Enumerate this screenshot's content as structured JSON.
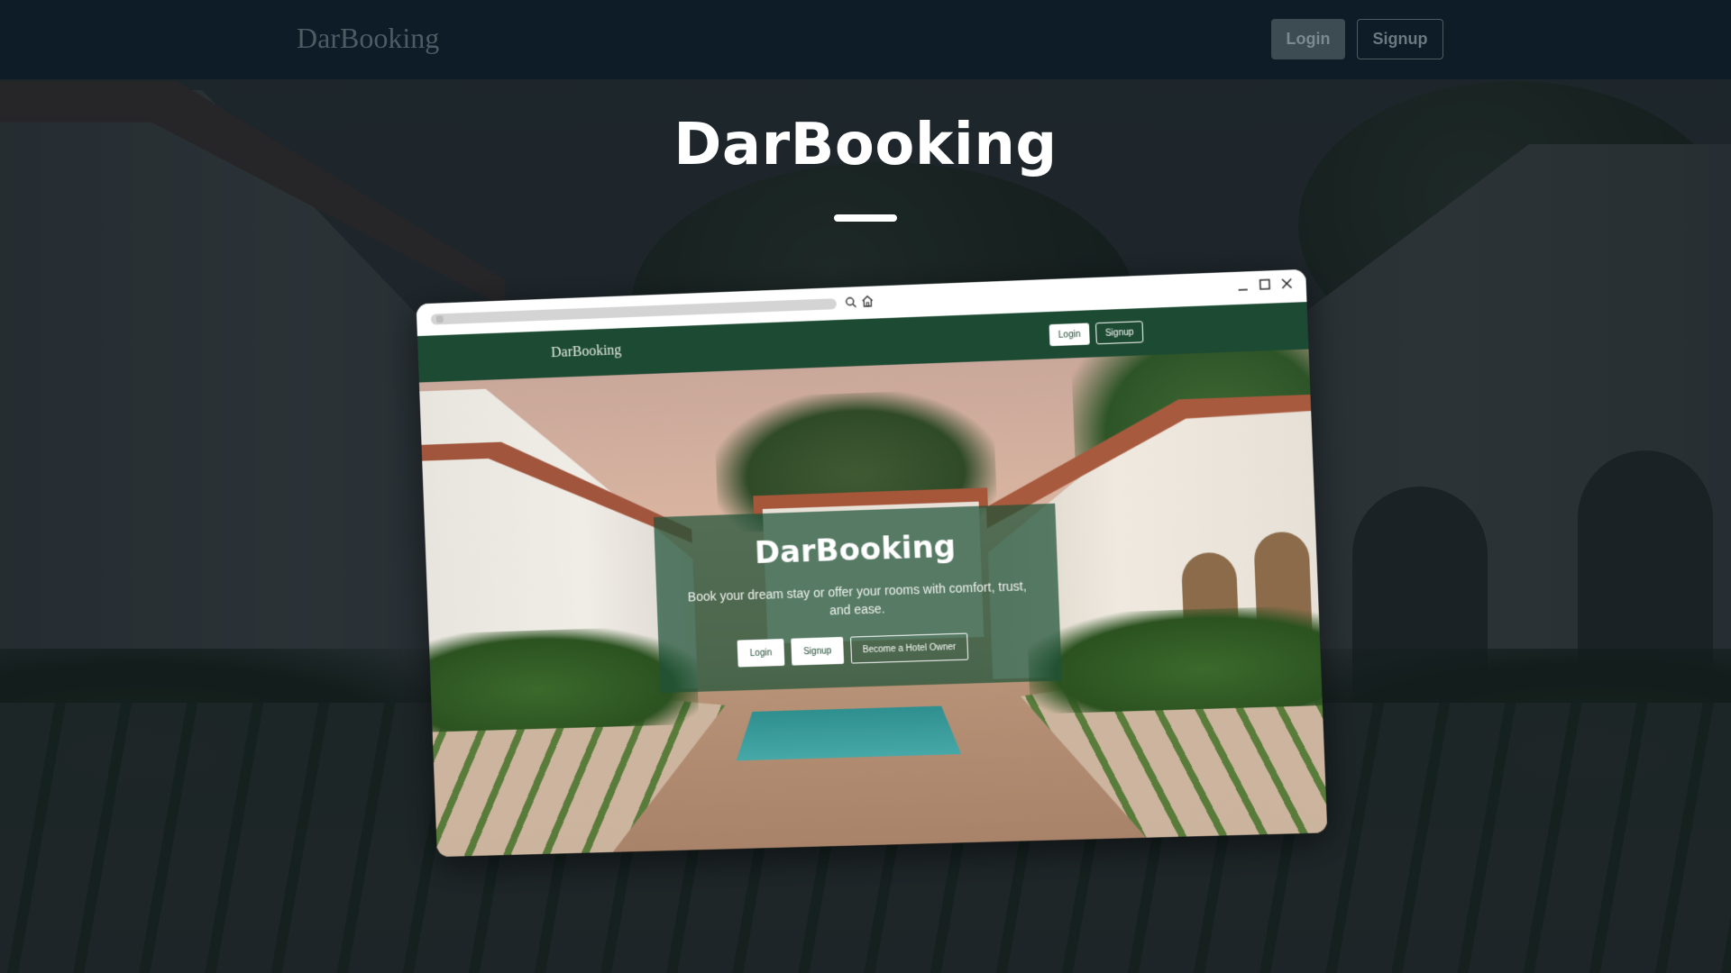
{
  "navbar": {
    "brand": "DarBooking",
    "login_label": "Login",
    "signup_label": "Signup"
  },
  "hero": {
    "title": "DarBooking"
  },
  "mockup": {
    "inner_nav": {
      "brand": "DarBooking",
      "login_label": "Login",
      "signup_label": "Signup"
    },
    "hero_card": {
      "title": "DarBooking",
      "subtitle": "Book your dream stay or offer your rooms with comfort, trust, and ease.",
      "login_label": "Login",
      "signup_label": "Signup",
      "owner_label": "Become a Hotel Owner"
    },
    "browser_icons": [
      "search-icon",
      "home-icon",
      "minimize-icon",
      "maximize-icon",
      "close-icon"
    ]
  },
  "colors": {
    "navbar_bg": "#0d1c26",
    "brand_green": "#1d4a32",
    "card_overlay": "rgba(30, 82, 56, 0.72)",
    "title_white": "#ffffff"
  }
}
